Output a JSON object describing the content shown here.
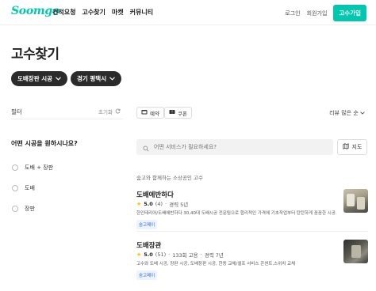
{
  "header": {
    "logo": "Soomgo",
    "nav": [
      "견적요청",
      "고수찾기",
      "마켓",
      "커뮤니티"
    ],
    "login": "로그인",
    "signup": "회원가입",
    "pro_signup": "고수가입"
  },
  "page": {
    "title": "고수찾기",
    "chips": [
      "도배장판 시공",
      "경기 평택시"
    ]
  },
  "filter": {
    "label": "필터",
    "reset": "초기화",
    "question": "어떤 시공을 원하시나요?",
    "options": [
      "도배 + 장판",
      "도배",
      "장판"
    ]
  },
  "toolbar": {
    "tags": [
      "예약",
      "쿠폰"
    ],
    "sort": "리뷰 많은 순"
  },
  "search": {
    "placeholder": "어떤 서비스가 필요하세요?",
    "map_button": "지도"
  },
  "list": {
    "subtitle": "숨고와 함께하는 소상공인 고수",
    "pros": [
      {
        "name": "도배에반하다",
        "rating": "5.0",
        "reviews": "(4)",
        "career": "경력 5년",
        "desc": "한인테리어/도배에반하다 30,40대 도배시공 전문팀으로 합리적인 가격에 기초작업부터 탄탄하게 꼼꼼한 시공...",
        "badge": "숨고페이"
      },
      {
        "name": "도배장관",
        "rating": "5.0",
        "reviews": "(51)",
        "hires": "133회 고용",
        "career": "경력 7년",
        "desc": "고수와 도배 시공, 장판 시공, 도배장판 시공, 한동 교체/셀프 서비스 콘센트,스위치 교체",
        "badge": "숨고페이"
      }
    ]
  },
  "colors": {
    "brand": "#00c7ae",
    "chip_bg": "#2b2b2b",
    "star": "#ffc107",
    "badge_text": "#2a6fd6"
  }
}
